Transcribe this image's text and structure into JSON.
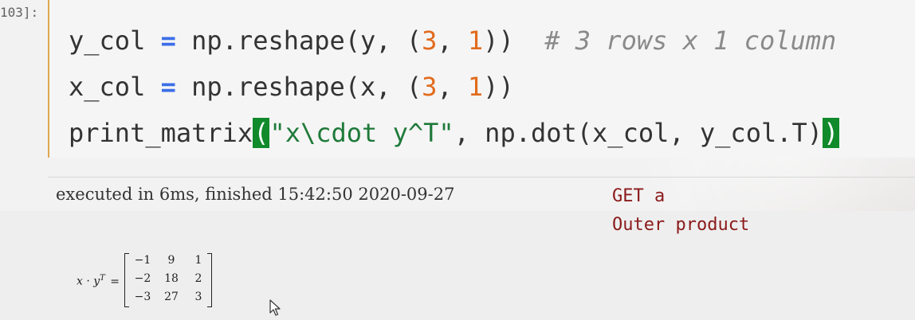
{
  "cell": {
    "prompt": "103]:",
    "code_lines": [
      [
        {
          "t": "y_col ",
          "c": "plain"
        },
        {
          "t": "=",
          "c": "op"
        },
        {
          "t": " np.reshape(y, (",
          "c": "plain"
        },
        {
          "t": "3",
          "c": "num"
        },
        {
          "t": ", ",
          "c": "plain"
        },
        {
          "t": "1",
          "c": "num"
        },
        {
          "t": "))  ",
          "c": "plain"
        },
        {
          "t": "# 3 rows x 1 column",
          "c": "cm"
        }
      ],
      [
        {
          "t": "x_col ",
          "c": "plain"
        },
        {
          "t": "=",
          "c": "op"
        },
        {
          "t": " np.reshape(x, (",
          "c": "plain"
        },
        {
          "t": "3",
          "c": "num"
        },
        {
          "t": ", ",
          "c": "plain"
        },
        {
          "t": "1",
          "c": "num"
        },
        {
          "t": "))",
          "c": "plain"
        }
      ],
      [
        {
          "t": "print_matrix",
          "c": "plain"
        },
        {
          "t": "(",
          "c": "hl"
        },
        {
          "t": "\"x\\cdot y^T\"",
          "c": "str"
        },
        {
          "t": ", np.dot(x_col, y_col.T)",
          "c": "plain"
        },
        {
          "t": ")",
          "c": "hl"
        }
      ]
    ],
    "execution_info": "executed in 6ms, finished 15:42:50 2020-09-27"
  },
  "annotation": {
    "line1": "GET a",
    "line2": "Outer product"
  },
  "output": {
    "lhs_base": "x · y",
    "lhs_sup": "T",
    "lhs_eq": "=",
    "matrix": [
      [
        "−1",
        "9",
        "1"
      ],
      [
        "−2",
        "18",
        "2"
      ],
      [
        "−3",
        "27",
        "3"
      ]
    ]
  },
  "icons": {
    "cursor": "mouse-pointer-icon"
  },
  "colors": {
    "keyword_operator": "#3c6ee8",
    "number": "#e26b1c",
    "comment": "#8a8a8a",
    "string": "#1f7a3a",
    "bracket_highlight": "#108a2a",
    "annotation_text": "#8b1a1a",
    "cell_edge": "#e0a84e"
  }
}
